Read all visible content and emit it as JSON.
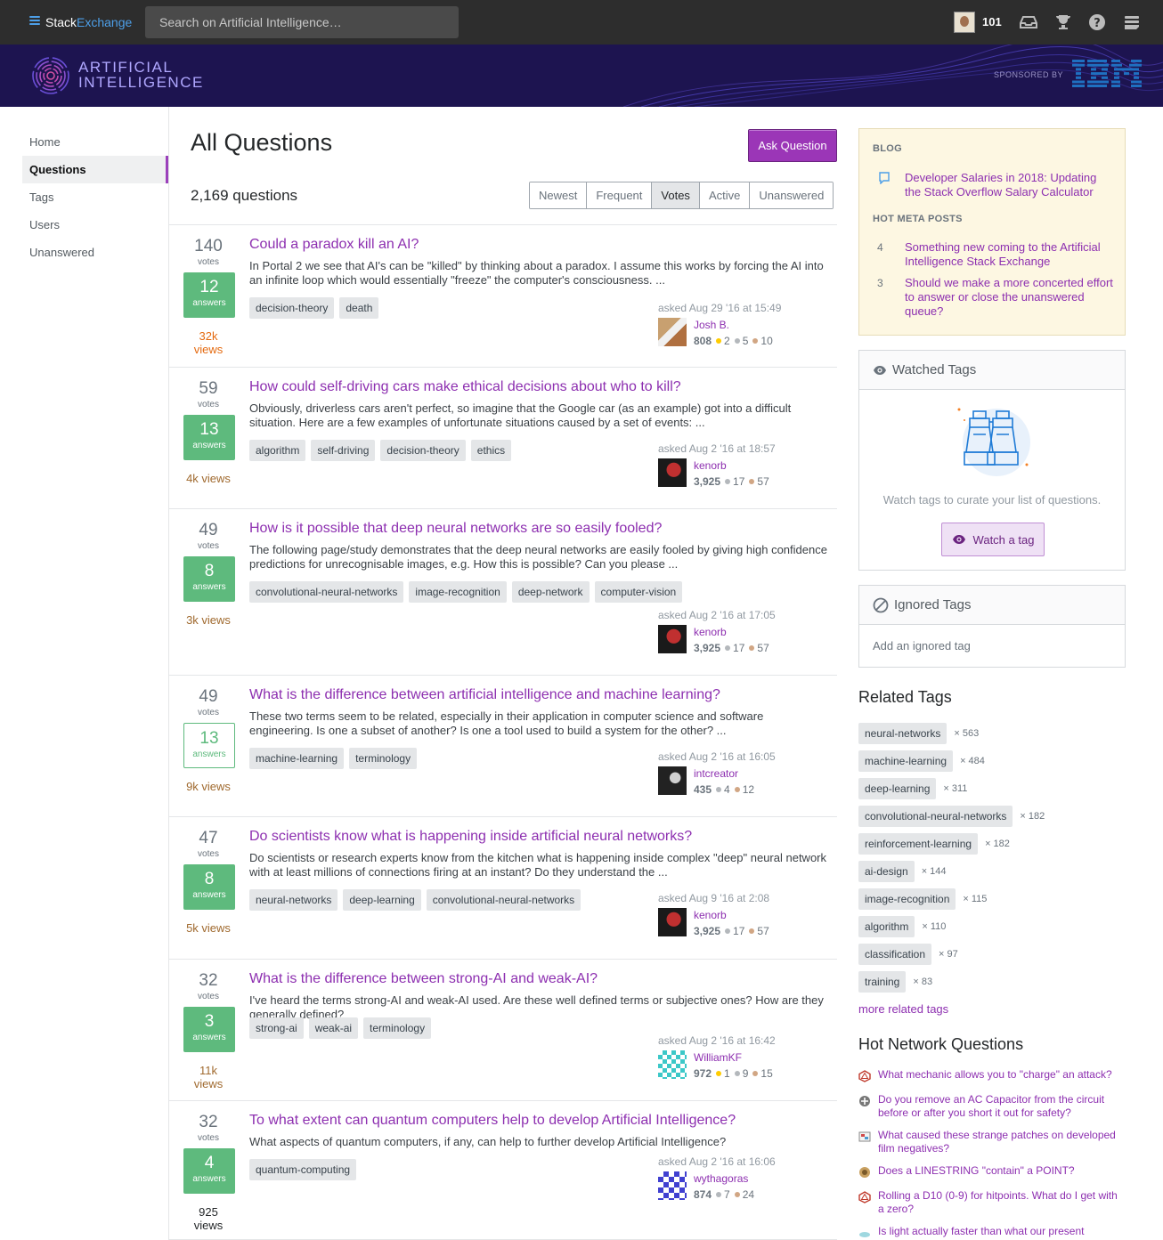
{
  "topbar": {
    "brand_a": "Stack",
    "brand_b": "Exchange",
    "search_placeholder": "Search on Artificial Intelligence…",
    "reputation": "101"
  },
  "banner": {
    "title_line1": "ARTIFICIAL",
    "title_line2": "INTELLIGENCE",
    "sponsored": "SPONSORED BY"
  },
  "nav": [
    "Home",
    "Questions",
    "Tags",
    "Users",
    "Unanswered"
  ],
  "main": {
    "title": "All Questions",
    "ask_button": "Ask Question",
    "count": "2,169 questions",
    "filters": [
      "Newest",
      "Frequent",
      "Votes",
      "Active",
      "Unanswered"
    ],
    "selected_filter": "Votes"
  },
  "questions": [
    {
      "votes": "140",
      "votes_label": "votes",
      "answers": "12",
      "answers_label": "answers",
      "accepted": true,
      "views": "32k views",
      "title": "Could a paradox kill an AI?",
      "excerpt": "In Portal 2 we see that AI's can be \"killed\" by thinking about a paradox. I assume this works by forcing the AI into an infinite loop which would essentially \"freeze\" the computer's consciousness. ...",
      "tags": [
        "decision-theory",
        "death"
      ],
      "asked": "asked Aug 29 '16 at 15:49",
      "user": "Josh B.",
      "rep": "808",
      "gold": "2",
      "silver": "5",
      "bronze": "10"
    },
    {
      "votes": "59",
      "votes_label": "votes",
      "answers": "13",
      "answers_label": "answers",
      "accepted": true,
      "views": "4k views",
      "title": "How could self-driving cars make ethical decisions about who to kill?",
      "excerpt": "Obviously, driverless cars aren't perfect, so imagine that the Google car (as an example) got into a difficult situation. Here are a few examples of unfortunate situations caused by a set of events: ...",
      "tags": [
        "algorithm",
        "self-driving",
        "decision-theory",
        "ethics"
      ],
      "asked": "asked Aug 2 '16 at 18:57",
      "user": "kenorb",
      "rep": "3,925",
      "gold": "",
      "silver": "17",
      "bronze": "57"
    },
    {
      "votes": "49",
      "votes_label": "votes",
      "answers": "8",
      "answers_label": "answers",
      "accepted": true,
      "views": "3k views",
      "title": "How is it possible that deep neural networks are so easily fooled?",
      "excerpt": "The following page/study demonstrates that the deep neural networks are easily fooled by giving high confidence predictions for unrecognisable images, e.g. How this is possible? Can you please ...",
      "tags": [
        "convolutional-neural-networks",
        "image-recognition",
        "deep-network",
        "computer-vision"
      ],
      "asked": "asked Aug 2 '16 at 17:05",
      "user": "kenorb",
      "rep": "3,925",
      "gold": "",
      "silver": "17",
      "bronze": "57"
    },
    {
      "votes": "49",
      "votes_label": "votes",
      "answers": "13",
      "answers_label": "answers",
      "accepted": false,
      "views": "9k views",
      "title": "What is the difference between artificial intelligence and machine learning?",
      "excerpt": "These two terms seem to be related, especially in their application in computer science and software engineering. Is one a subset of another? Is one a tool used to build a system for the other? ...",
      "tags": [
        "machine-learning",
        "terminology"
      ],
      "asked": "asked Aug 2 '16 at 16:05",
      "user": "intcreator",
      "rep": "435",
      "gold": "",
      "silver": "4",
      "bronze": "12"
    },
    {
      "votes": "47",
      "votes_label": "votes",
      "answers": "8",
      "answers_label": "answers",
      "accepted": true,
      "views": "5k views",
      "title": "Do scientists know what is happening inside artificial neural networks?",
      "excerpt": "Do scientists or research experts know from the kitchen what is happening inside complex \"deep\" neural network with at least millions of connections firing at an instant? Do they understand the ...",
      "tags": [
        "neural-networks",
        "deep-learning",
        "convolutional-neural-networks"
      ],
      "asked": "asked Aug 9 '16 at 2:08",
      "user": "kenorb",
      "rep": "3,925",
      "gold": "",
      "silver": "17",
      "bronze": "57"
    },
    {
      "votes": "32",
      "votes_label": "votes",
      "answers": "3",
      "answers_label": "answers",
      "accepted": true,
      "views": "11k views",
      "title": "What is the difference between strong-AI and weak-AI?",
      "excerpt": "I've heard the terms strong-AI and weak-AI used. Are these well defined terms or subjective ones? How are they generally defined?",
      "tags": [
        "strong-ai",
        "weak-ai",
        "terminology"
      ],
      "asked": "asked Aug 2 '16 at 16:42",
      "user": "WilliamKF",
      "rep": "972",
      "gold": "1",
      "silver": "9",
      "bronze": "15"
    },
    {
      "votes": "32",
      "votes_label": "votes",
      "answers": "4",
      "answers_label": "answers",
      "accepted": true,
      "views": "925 views",
      "title": "To what extent can quantum computers help to develop Artificial Intelligence?",
      "excerpt": "What aspects of quantum computers, if any, can help to further develop Artificial Intelligence?",
      "tags": [
        "quantum-computing"
      ],
      "asked": "asked Aug 2 '16 at 16:06",
      "user": "wythagoras",
      "rep": "874",
      "gold": "",
      "silver": "7",
      "bronze": "24"
    }
  ],
  "sidebar": {
    "blog_head": "BLOG",
    "blog_link": "Developer Salaries in 2018: Updating the Stack Overflow Salary Calculator",
    "meta_head": "HOT META POSTS",
    "meta_posts": [
      {
        "num": "4",
        "text": "Something new coming to the Artificial Intelligence Stack Exchange"
      },
      {
        "num": "3",
        "text": "Should we make a more concerted effort to answer or close the unanswered queue?"
      }
    ],
    "watched_title": "Watched Tags",
    "watched_text": "Watch tags to curate your list of questions.",
    "watch_button": "Watch a tag",
    "ignored_title": "Ignored Tags",
    "ignored_text": "Add an ignored tag",
    "related_title": "Related Tags",
    "related_tags": [
      {
        "tag": "neural-networks",
        "count": "× 563"
      },
      {
        "tag": "machine-learning",
        "count": "× 484"
      },
      {
        "tag": "deep-learning",
        "count": "× 311"
      },
      {
        "tag": "convolutional-neural-networks",
        "count": "× 182"
      },
      {
        "tag": "reinforcement-learning",
        "count": "× 182"
      },
      {
        "tag": "ai-design",
        "count": "× 144"
      },
      {
        "tag": "image-recognition",
        "count": "× 115"
      },
      {
        "tag": "algorithm",
        "count": "× 110"
      },
      {
        "tag": "classification",
        "count": "× 97"
      },
      {
        "tag": "training",
        "count": "× 83"
      }
    ],
    "more_related": "more related tags",
    "hnq_title": "Hot Network Questions",
    "hnq": [
      {
        "icon": "rpg-icon",
        "text": "What mechanic allows you to \"charge\" an attack?"
      },
      {
        "icon": "electronics-icon",
        "text": "Do you remove an AC Capacitor from the circuit before or after you short it out for safety?"
      },
      {
        "icon": "photo-icon",
        "text": "What caused these strange patches on developed film negatives?"
      },
      {
        "icon": "gis-icon",
        "text": "Does a LINESTRING \"contain\" a POINT?"
      },
      {
        "icon": "rpg-icon",
        "text": "Rolling a D10 (0-9) for hitpoints. What do I get with a zero?"
      },
      {
        "icon": "physics-icon",
        "text": "Is light actually faster than what our present"
      }
    ]
  },
  "colors": {
    "accent": "#9b36b7",
    "link": "#8d2fb0",
    "answered": "#5eba7d",
    "topbar": "#2d2d2d",
    "banner": "#1d1450"
  }
}
